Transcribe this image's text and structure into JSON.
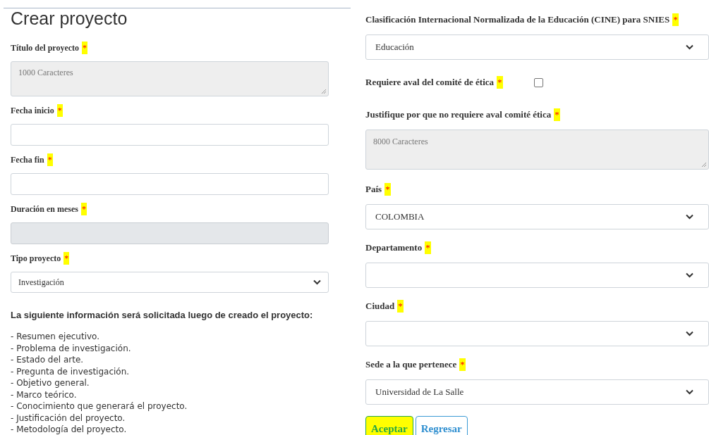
{
  "title": "Crear proyecto",
  "left_fields": [
    {
      "kind": "textarea",
      "label": "Título del proyecto",
      "mark": "*",
      "placeholder": "1000 Caracteres",
      "disabled": true
    },
    {
      "kind": "input",
      "label": "Fecha inicio",
      "mark": "*",
      "disabled": false
    },
    {
      "kind": "input",
      "label": "Fecha fin",
      "mark": "*",
      "disabled": false
    },
    {
      "kind": "input",
      "label": "Duración en meses",
      "mark": "*",
      "disabled": true
    },
    {
      "kind": "select",
      "label": "Tipo proyecto",
      "mark": "*",
      "value": "Investigación"
    }
  ],
  "info": {
    "heading": "La siguiente información será solicitada luego de creado el proyecto:",
    "items": [
      "- Resumen ejecutivo.",
      "- Problema de investigación.",
      "- Estado del arte.",
      "- Pregunta de investigación.",
      "- Objetivo general.",
      "- Marco teórico.",
      "- Conocimiento que generará el proyecto.",
      "- Justificación del proyecto.",
      "- Metodología del proyecto."
    ]
  },
  "right_fields": [
    {
      "kind": "select",
      "label": "Clasificación Internacional Normalizada de la Educación (CINE) para SNIES",
      "mark": "*",
      "value": "Educación"
    },
    {
      "kind": "checkbox",
      "label": "Requiere aval del comité de ética",
      "mark": "*",
      "checked": false
    },
    {
      "kind": "textarea",
      "label": "Justifique por que no requiere aval comité ética",
      "mark": "*",
      "placeholder": "8000 Caracteres",
      "disabled": true
    },
    {
      "kind": "select",
      "label": "País",
      "mark": "*",
      "value": "COLOMBIA"
    },
    {
      "kind": "select",
      "label": "Departamento",
      "mark": "*"
    },
    {
      "kind": "select",
      "label": "Ciudad",
      "mark": "*"
    },
    {
      "kind": "select",
      "label": "Sede a la que pertenece",
      "mark": "*",
      "value": "Universidad de La Salle"
    }
  ],
  "buttons": [
    {
      "label": "Aceptar",
      "kind": "primary"
    },
    {
      "label": "Regresar",
      "kind": "secondary"
    }
  ]
}
